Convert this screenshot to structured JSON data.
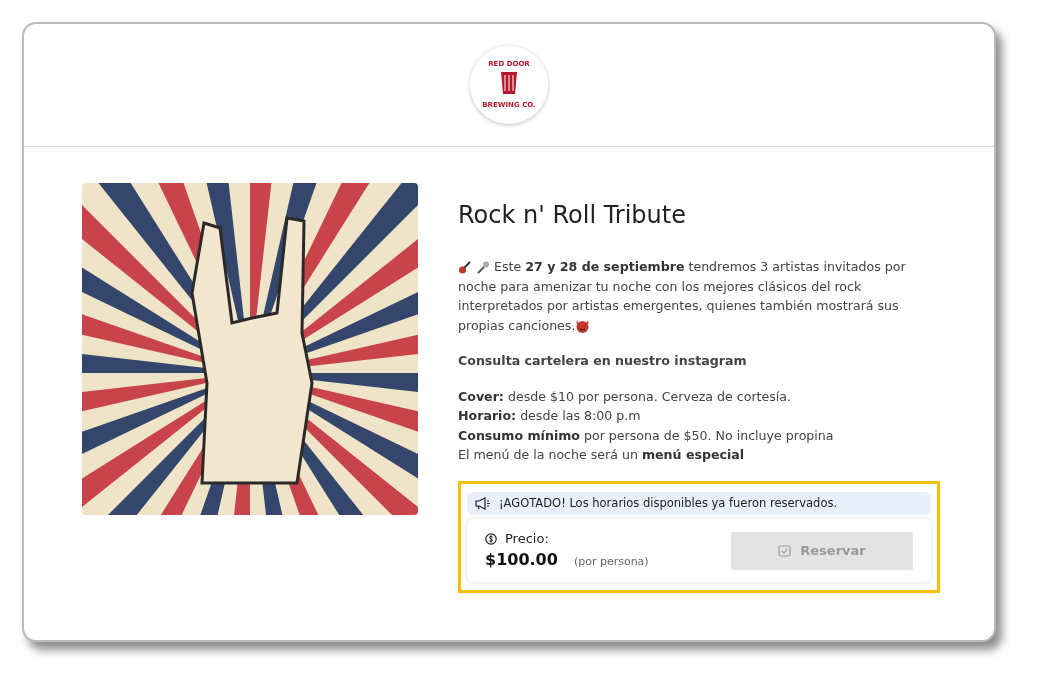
{
  "logo": {
    "top_text": "RED DOOR",
    "bottom_text": "BREWING CO."
  },
  "event": {
    "title": "Rock n' Roll Tribute",
    "intro": "Este **27 y 28 de septiembre** tendremos 3 artistas invitados por noche para amenizar tu noche con los mejores clásicos del rock interpretados por artistas emergentes, quienes también mostrará sus propias canciones.",
    "notice": "Consulta cartelera en nuestro instagram",
    "details": [
      "**Cover:** desde $10 por persona. Cerveza de cortesía.",
      "**Horario:** desde las 8:00 p.m",
      "**Consumo mínimo** por persona de $50. No incluye propina",
      "El menú de la noche será un **menú especial**"
    ]
  },
  "booking": {
    "alert": "¡AGOTADO! Los horarios disponibles ya fueron reservados.",
    "price_label": "Precio:",
    "price": "$100.00",
    "price_unit": "(por persona)",
    "button": {
      "label": "Reservar",
      "disabled": true
    }
  }
}
